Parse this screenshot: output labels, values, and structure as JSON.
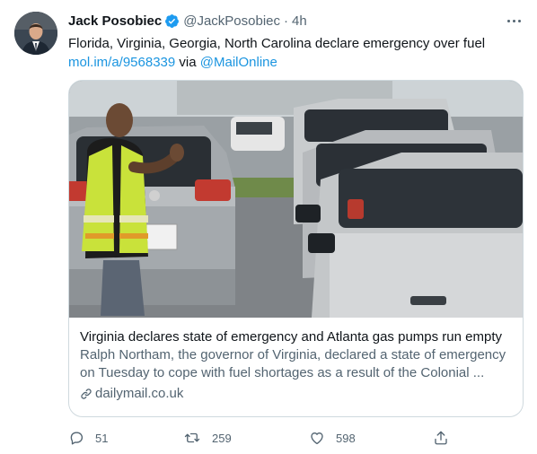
{
  "tweet": {
    "author": {
      "name": "Jack Posobiec",
      "handle": "@JackPosobiec",
      "verified": true,
      "avatar_icon": "person-avatar-icon"
    },
    "timestamp": "4h",
    "text": "Florida, Virginia, Georgia, North Carolina declare emergency over fuel",
    "link_short": "mol.im/a/9568339",
    "via_word": "via",
    "via_handle": "@MailOnline",
    "card": {
      "title": "Virginia declares state of emergency and Atlanta gas pumps run empty",
      "description": "Ralph Northam, the governor of Virginia, declared a state of emergency on Tuesday to cope with fuel shortages as a result of the Colonial ...",
      "domain": "dailymail.co.uk",
      "image_icon": "news-photo-man-directing-cars"
    },
    "actions": {
      "replies": "51",
      "retweets": "259",
      "likes": "598"
    }
  },
  "colors": {
    "link": "#1b95e0",
    "secondary_text": "#536471",
    "border": "#cfd9de",
    "verified": "#1d9bf0"
  }
}
